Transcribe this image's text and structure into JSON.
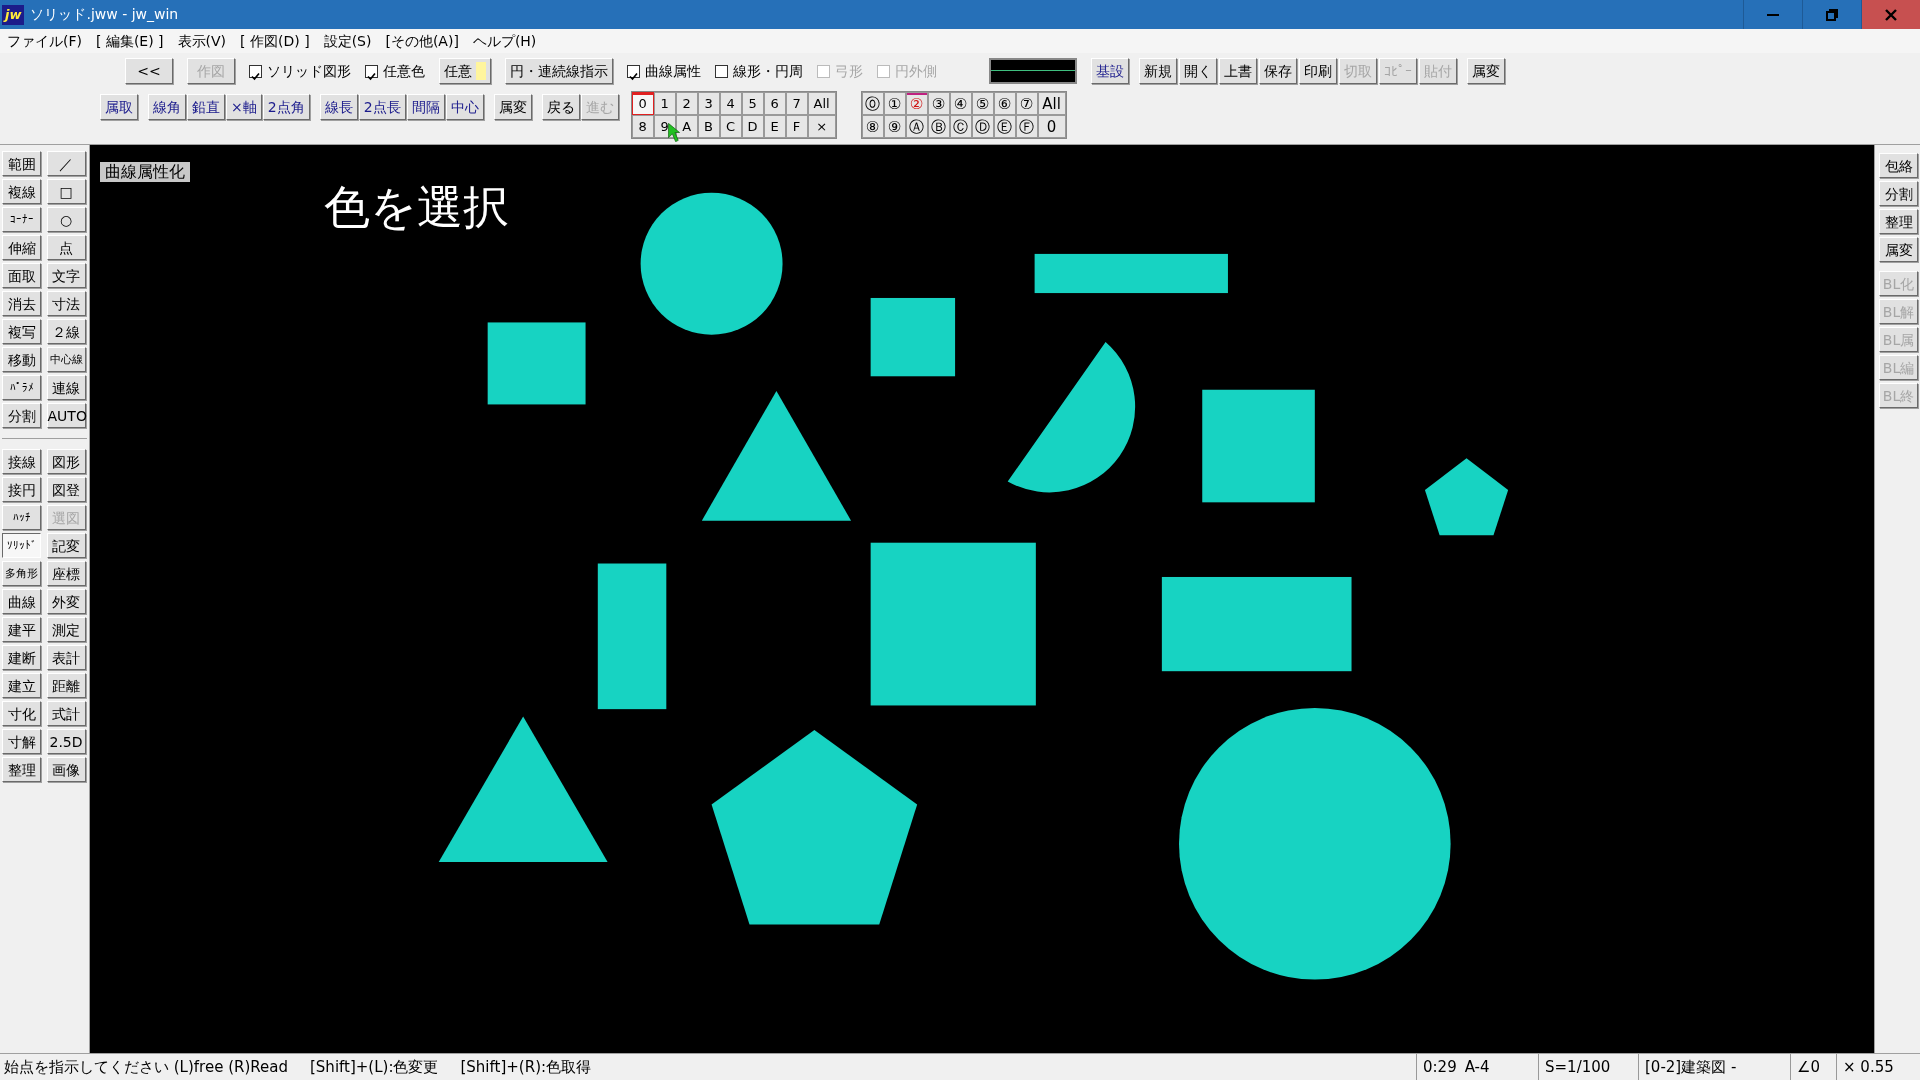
{
  "window": {
    "app_icon": "jw",
    "title": "ソリッド.jww - jw_win"
  },
  "menu": [
    "ファイル(F)",
    "[ 編集(E) ]",
    "表示(V)",
    "[ 作図(D) ]",
    "設定(S)",
    "[その他(A)]",
    "ヘルプ(H)"
  ],
  "toolbar_row1": [
    {
      "kind": "button",
      "label": "<<",
      "disabled": false
    },
    {
      "kind": "button",
      "label": "作図",
      "disabled": true
    },
    {
      "kind": "checkbox",
      "label": "ソリッド図形",
      "checked": true,
      "disabled": false
    },
    {
      "kind": "checkbox",
      "label": "任意色",
      "checked": true,
      "disabled": false
    },
    {
      "kind": "color_button",
      "label": "任意",
      "color": "#fff59d"
    },
    {
      "kind": "button",
      "label": "円・連続線指示",
      "disabled": false
    },
    {
      "kind": "checkbox",
      "label": "曲線属性",
      "checked": true,
      "disabled": false
    },
    {
      "kind": "checkbox",
      "label": "線形・円周",
      "checked": false,
      "disabled": false
    },
    {
      "kind": "checkbox",
      "label": "弓形",
      "checked": false,
      "disabled": true
    },
    {
      "kind": "checkbox",
      "label": "円外側",
      "checked": false,
      "disabled": true
    }
  ],
  "file_toolbar": [
    {
      "label": "基設",
      "highlighted": true,
      "disabled": false
    },
    {
      "label": "新規",
      "highlighted": false,
      "disabled": false
    },
    {
      "label": "開く",
      "highlighted": false,
      "disabled": false
    },
    {
      "label": "上書",
      "highlighted": false,
      "disabled": false
    },
    {
      "label": "保存",
      "highlighted": false,
      "disabled": false
    },
    {
      "label": "印刷",
      "highlighted": false,
      "disabled": false
    },
    {
      "label": "切取",
      "highlighted": false,
      "disabled": true
    },
    {
      "label": "ｺﾋﾟｰ",
      "highlighted": false,
      "disabled": true
    },
    {
      "label": "貼付",
      "highlighted": false,
      "disabled": true
    },
    {
      "label": "属変",
      "highlighted": false,
      "disabled": false
    }
  ],
  "toolbar_row2": [
    [
      {
        "label": "属取",
        "highlighted": true,
        "disabled": false
      }
    ],
    [
      {
        "label": "線角",
        "highlighted": true,
        "disabled": false
      },
      {
        "label": "鉛直",
        "highlighted": true,
        "disabled": false
      },
      {
        "label": "×軸",
        "highlighted": true,
        "disabled": false
      },
      {
        "label": "2点角",
        "highlighted": true,
        "disabled": false
      }
    ],
    [
      {
        "label": "線長",
        "highlighted": true,
        "disabled": false
      },
      {
        "label": "2点長",
        "highlighted": true,
        "disabled": false
      },
      {
        "label": "間隔",
        "highlighted": true,
        "disabled": false
      },
      {
        "label": "中心",
        "highlighted": true,
        "disabled": false
      }
    ],
    [
      {
        "label": "属変",
        "highlighted": false,
        "disabled": false
      }
    ],
    [
      {
        "label": "戻る",
        "highlighted": false,
        "disabled": false
      },
      {
        "label": "進む",
        "highlighted": false,
        "disabled": true
      }
    ]
  ],
  "layers": {
    "rows": [
      [
        {
          "label": "0",
          "selected": true
        },
        {
          "label": "1",
          "selected": false
        },
        {
          "label": "2",
          "selected": false
        },
        {
          "label": "3",
          "selected": false
        },
        {
          "label": "4",
          "selected": false
        },
        {
          "label": "5",
          "selected": false
        },
        {
          "label": "6",
          "selected": false
        },
        {
          "label": "7",
          "selected": false
        }
      ],
      [
        {
          "label": "8",
          "selected": false
        },
        {
          "label": "9",
          "selected": false
        },
        {
          "label": "A",
          "selected": false
        },
        {
          "label": "B",
          "selected": false
        },
        {
          "label": "C",
          "selected": false
        },
        {
          "label": "D",
          "selected": false
        },
        {
          "label": "E",
          "selected": false
        },
        {
          "label": "F",
          "selected": false
        }
      ]
    ],
    "actions": [
      "All",
      "×"
    ]
  },
  "layer_groups": {
    "rows": [
      [
        {
          "label": "⓪",
          "selected": false
        },
        {
          "label": "①",
          "selected": false
        },
        {
          "label": "②",
          "selected": true
        },
        {
          "label": "③",
          "selected": false
        },
        {
          "label": "④",
          "selected": false
        },
        {
          "label": "⑤",
          "selected": false
        },
        {
          "label": "⑥",
          "selected": false
        },
        {
          "label": "⑦",
          "selected": false
        }
      ],
      [
        {
          "label": "⑧",
          "selected": false
        },
        {
          "label": "⑨",
          "selected": false
        },
        {
          "label": "Ⓐ",
          "selected": false
        },
        {
          "label": "Ⓑ",
          "selected": false
        },
        {
          "label": "Ⓒ",
          "selected": false
        },
        {
          "label": "Ⓓ",
          "selected": false
        },
        {
          "label": "Ⓔ",
          "selected": false
        },
        {
          "label": "Ⓕ",
          "selected": false
        }
      ]
    ],
    "actions": [
      "All",
      "0"
    ]
  },
  "left_toolbar": [
    [
      [
        {
          "label": "範囲",
          "selected": false,
          "disabled": false
        },
        {
          "label": "複線",
          "selected": false,
          "disabled": false
        },
        {
          "label": "ｺｰﾅｰ",
          "selected": false,
          "disabled": false
        },
        {
          "label": "伸縮",
          "selected": false,
          "disabled": false
        },
        {
          "label": "面取",
          "selected": false,
          "disabled": false
        },
        {
          "label": "消去",
          "selected": false,
          "disabled": false
        },
        {
          "label": "複写",
          "selected": false,
          "disabled": false
        },
        {
          "label": "移動",
          "selected": false,
          "disabled": false
        },
        {
          "label": "ﾊﾟﾗﾒ",
          "selected": false,
          "disabled": false
        },
        {
          "label": "分割",
          "selected": false,
          "disabled": false
        }
      ],
      [
        {
          "label": "／",
          "selected": false,
          "disabled": false
        },
        {
          "label": "□",
          "selected": false,
          "disabled": false
        },
        {
          "label": "○",
          "selected": false,
          "disabled": false
        },
        {
          "label": "点",
          "selected": false,
          "disabled": false
        },
        {
          "label": "文字",
          "selected": false,
          "disabled": false
        },
        {
          "label": "寸法",
          "selected": false,
          "disabled": false
        },
        {
          "label": "２線",
          "selected": false,
          "disabled": false
        },
        {
          "label": "中心線",
          "selected": false,
          "disabled": false
        },
        {
          "label": "連線",
          "selected": false,
          "disabled": false
        },
        {
          "label": "AUTO",
          "selected": false,
          "disabled": false
        }
      ]
    ],
    [
      [
        {
          "label": "接線",
          "selected": false,
          "disabled": false
        },
        {
          "label": "接円",
          "selected": false,
          "disabled": false
        },
        {
          "label": "ﾊｯﾁ",
          "selected": false,
          "disabled": false
        },
        {
          "label": "ｿﾘｯﾄﾞ",
          "selected": true,
          "disabled": false
        },
        {
          "label": "多角形",
          "selected": false,
          "disabled": false
        },
        {
          "label": "曲線",
          "selected": false,
          "disabled": false
        },
        {
          "label": "建平",
          "selected": false,
          "disabled": false
        },
        {
          "label": "建断",
          "selected": false,
          "disabled": false
        },
        {
          "label": "建立",
          "selected": false,
          "disabled": false
        },
        {
          "label": "寸化",
          "selected": false,
          "disabled": false
        },
        {
          "label": "寸解",
          "selected": false,
          "disabled": false
        },
        {
          "label": "整理",
          "selected": false,
          "disabled": false
        }
      ],
      [
        {
          "label": "図形",
          "selected": false,
          "disabled": false
        },
        {
          "label": "図登",
          "selected": false,
          "disabled": false
        },
        {
          "label": "選図",
          "selected": false,
          "disabled": true
        },
        {
          "label": "記変",
          "selected": false,
          "disabled": false
        },
        {
          "label": "座標",
          "selected": false,
          "disabled": false
        },
        {
          "label": "外変",
          "selected": false,
          "disabled": false
        },
        {
          "label": "測定",
          "selected": false,
          "disabled": false
        },
        {
          "label": "表計",
          "selected": false,
          "disabled": false
        },
        {
          "label": "距離",
          "selected": false,
          "disabled": false
        },
        {
          "label": "式計",
          "selected": false,
          "disabled": false
        },
        {
          "label": "2.5D",
          "selected": false,
          "disabled": false
        },
        {
          "label": "画像",
          "selected": false,
          "disabled": false
        }
      ]
    ]
  ],
  "right_toolbar": [
    {
      "label": "包絡",
      "disabled": false
    },
    {
      "label": "分割",
      "disabled": false
    },
    {
      "label": "整理",
      "disabled": false
    },
    {
      "label": "属変",
      "disabled": false
    },
    {
      "label": "BL化",
      "disabled": true
    },
    {
      "label": "BL解",
      "disabled": true
    },
    {
      "label": "BL属",
      "disabled": true
    },
    {
      "label": "BL編",
      "disabled": true
    },
    {
      "label": "BL終",
      "disabled": true
    }
  ],
  "canvas": {
    "mode_label": "曲線属性化",
    "caption": "色を選択"
  },
  "status_bar": {
    "messages": [
      "始点を指示してください (L)free (R)Read",
      "[Shift]+(L):色変更",
      "[Shift]+(R):色取得"
    ],
    "panels": [
      [
        "0:29",
        "A-4"
      ],
      [
        "S=1/100"
      ],
      [
        "[0-2]建築図 -"
      ],
      [
        "∠0"
      ],
      [
        "× 0.55"
      ]
    ]
  }
}
